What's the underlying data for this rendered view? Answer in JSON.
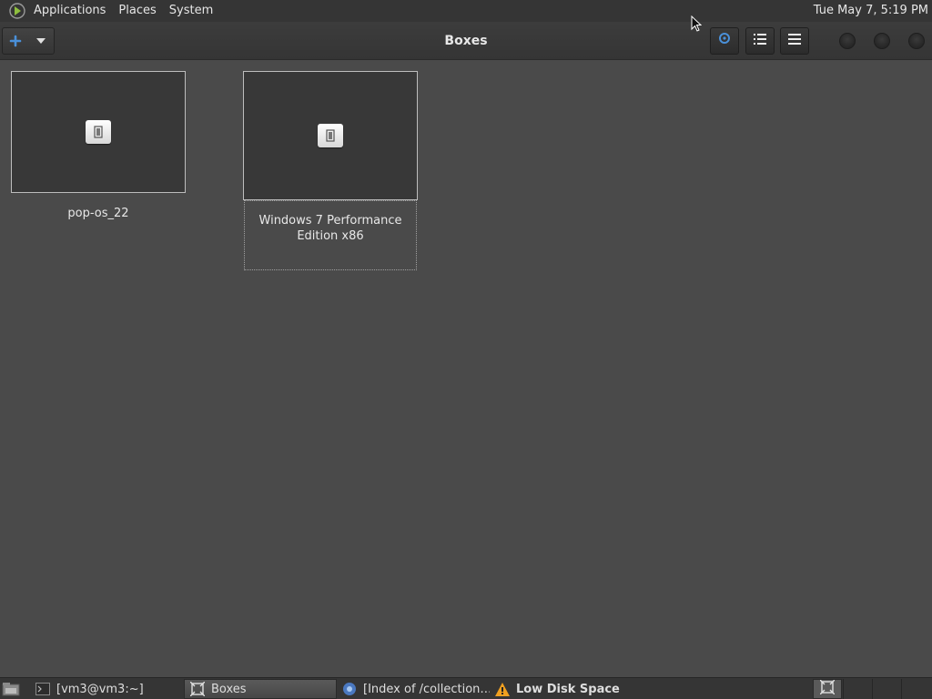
{
  "top_panel": {
    "menus": [
      "Applications",
      "Places",
      "System"
    ],
    "clock": "Tue May  7,  5:19 PM"
  },
  "header": {
    "title": "Boxes",
    "new_button_icon": "plus-icon",
    "search_icon": "search-icon",
    "list_view_icon": "list-view-icon",
    "menu_icon": "hamburger-menu-icon"
  },
  "boxes": [
    {
      "name": "pop-os_22",
      "icon": "vm-display-icon"
    },
    {
      "name_line1": "Windows 7 Performance",
      "name_line2": "Edition x86",
      "icon": "vm-display-icon"
    }
  ],
  "taskbar": {
    "tasks": [
      {
        "label": "[vm3@vm3:~]",
        "icon": "terminal-icon"
      },
      {
        "label": "Boxes",
        "icon": "boxes-icon"
      },
      {
        "label": "[Index of /collection…",
        "icon": "browser-icon"
      },
      {
        "label": "Low Disk Space",
        "icon": "warning-icon"
      }
    ]
  },
  "colors": {
    "accent_blue": "#4a90d9",
    "warning_orange": "#f0a020",
    "panel_bg": "#353535",
    "content_bg": "#4a4a4a"
  }
}
